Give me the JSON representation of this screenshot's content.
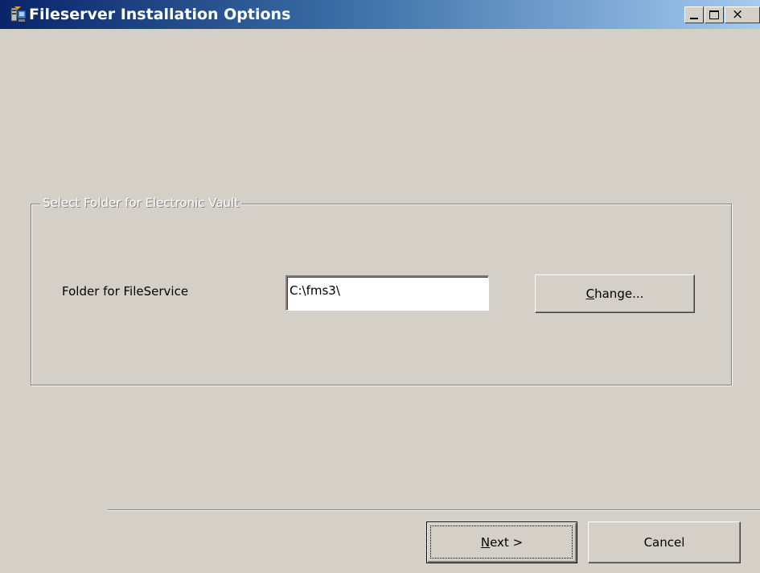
{
  "window": {
    "title": "Fileserver Installation Options",
    "controls": {
      "minimize": "_",
      "maximize": "□",
      "close": "×"
    }
  },
  "group": {
    "legend": "Select Folder for Electronic Vault",
    "folder_label": "Folder for FileService",
    "folder_value": "C:\\fms3\\",
    "change_button": {
      "mnemonic": "C",
      "rest": "hange..."
    }
  },
  "footer": {
    "next_button": {
      "mnemonic": "N",
      "rest": "ext >"
    },
    "cancel_button": "Cancel"
  }
}
